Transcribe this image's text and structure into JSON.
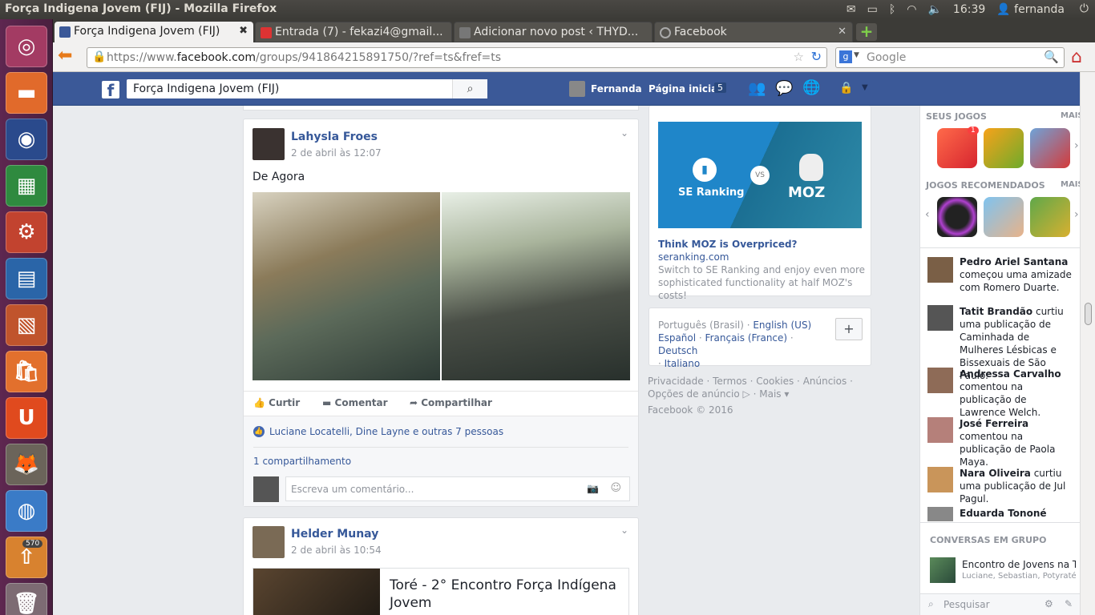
{
  "os": {
    "window_title": "Força Indigena Jovem (FIJ) - Mozilla Firefox",
    "clock": "16:39",
    "user": "fernanda",
    "launcher_badge": "570"
  },
  "browser": {
    "tabs": [
      {
        "label": "Força Indigena Jovem (FIJ)"
      },
      {
        "label": "Entrada (7) - fekazi4@gmail..."
      },
      {
        "label": "Adicionar novo post ‹ THYD..."
      },
      {
        "label": "Facebook"
      }
    ],
    "url_prefix": "https://www.",
    "url_domain": "facebook.com",
    "url_rest": "/groups/941864215891750/?ref=ts&fref=ts",
    "search_placeholder": "Google"
  },
  "fb": {
    "search_value": "Força Indigena Jovem (FIJ)",
    "profile_name": "Fernanda",
    "home_label": "Página inicial",
    "home_count": "5"
  },
  "posts": [
    {
      "author": "Lahysla Froes",
      "time": "2 de abril às 12:07",
      "text": "De Agora",
      "actions": [
        "Curtir",
        "Comentar",
        "Compartilhar"
      ],
      "likes": "Luciane Locatelli, Dine Layne e outras 7 pessoas",
      "shares": "1 compartilhamento",
      "comment_placeholder": "Escreva um comentário..."
    },
    {
      "author": "Helder Munay",
      "time": "2 de abril às 10:54",
      "link_title": "Toré - 2° Encontro Força Indígena Jovem"
    }
  ],
  "ad": {
    "brand_left": "SE Ranking",
    "vs": "VS",
    "brand_right": "MOZ",
    "title": "Think MOZ is Overpriced?",
    "domain": "seranking.com",
    "desc": "Switch to SE Ranking and enjoy even more sophisticated functionality at half MOZ's costs!"
  },
  "languages": {
    "current": "Português (Brasil)",
    "items": [
      "English (US)",
      "Español",
      "Français (France)",
      "Deutsch",
      "Italiano"
    ]
  },
  "footer": {
    "links": [
      "Privacidade",
      "Termos",
      "Cookies",
      "Anúncios",
      "Opções de anúncio",
      "Mais"
    ],
    "copyright": "Facebook © 2016"
  },
  "sidebar": {
    "my_games": "SEUS JOGOS",
    "more": "MAIS",
    "game_badge": "1",
    "recommended": "JOGOS RECOMENDADOS",
    "ticker": [
      {
        "name": "Pedro Ariel Santana",
        "text": "começou uma amizade com Romero Duarte."
      },
      {
        "name": "Tatit Brandão",
        "text": "curtiu uma publicação de Caminhada de Mulheres Lésbicas e Bissexuais de São Paulo."
      },
      {
        "name": "Andressa Carvalho",
        "text": "comentou na publicação de Lawrence Welch."
      },
      {
        "name": "José Ferreira",
        "text": "comentou na publicação de Paola Maya."
      },
      {
        "name": "Nara Oliveira",
        "text": "curtiu uma publicação de Jul Pagul."
      },
      {
        "name": "Eduarda Tononé",
        "text": ""
      }
    ],
    "group_chats_title": "CONVERSAS EM GRUPO",
    "group_chat": {
      "name": "Encontro de Jovens na T...",
      "members": "Luciane, Sebastian, Potyraté, ..."
    },
    "chat_search": "Pesquisar"
  }
}
